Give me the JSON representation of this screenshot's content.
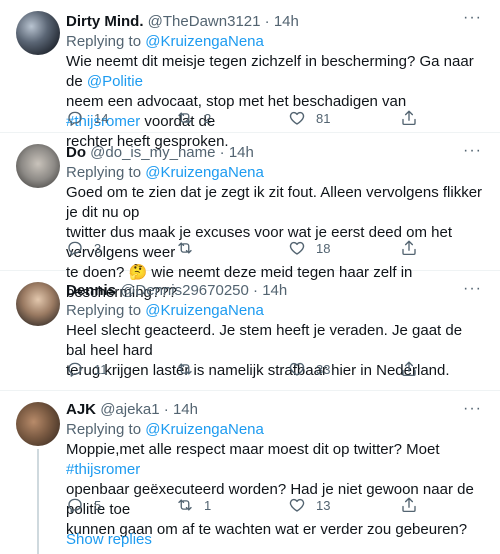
{
  "replies": [
    {
      "name": "Dirty Mind.",
      "handle": "@TheDawn3121",
      "dot": "·",
      "time": "14h",
      "replying_prefix": "Replying to",
      "replying_to": "@KruizengaNena",
      "lines": [
        [
          "Wie neemt dit meisje tegen zichzelf in bescherming? Ga naar de ",
          "@Politie"
        ],
        [
          "neem een advocaat, stop met het beschadigen van ",
          "#thijsromer",
          " voordat de"
        ],
        [
          "rechter heeft gesproken."
        ]
      ],
      "replies_count": "14",
      "retweets_count": "2",
      "likes_count": "81"
    },
    {
      "name": "Do",
      "handle": "@do_is_my_name",
      "dot": "·",
      "time": "14h",
      "replying_prefix": "Replying to",
      "replying_to": "@KruizengaNena",
      "lines": [
        [
          "Goed om te zien dat je zegt ik zit fout. Alleen vervolgens flikker je dit nu op"
        ],
        [
          "twitter dus maak je excuses voor wat je eerst deed om het vervolgens weer"
        ],
        [
          "te doen? 🤔 wie neemt deze meid tegen haar zelf in bescherming???"
        ]
      ],
      "replies_count": "3",
      "retweets_count": "",
      "likes_count": "18"
    },
    {
      "name": "Dennis",
      "handle": "@Dennis29670250",
      "dot": "·",
      "time": "14h",
      "replying_prefix": "Replying to",
      "replying_to": "@KruizengaNena",
      "lines": [
        [
          "Heel slecht geacteerd. Je stem heeft je veraden. Je gaat de bal heel hard"
        ],
        [
          "terug krijgen laster is namelijk strafbaar hier in Nederland."
        ]
      ],
      "replies_count": "11",
      "retweets_count": "",
      "likes_count": "33"
    },
    {
      "name": "AJK",
      "handle": "@ajeka1",
      "dot": "·",
      "time": "14h",
      "replying_prefix": "Replying to",
      "replying_to": "@KruizengaNena",
      "lines": [
        [
          "Moppie,met alle respect maar moest dit op twitter? Moet ",
          "#thijsromer"
        ],
        [
          "openbaar geëxecuteerd worden? Had je niet gewoon naar de politie toe"
        ],
        [
          "kunnen gaan om af te wachten wat er verder zou gebeuren?"
        ]
      ],
      "replies_count": "5",
      "retweets_count": "1",
      "likes_count": "13"
    }
  ],
  "show_replies_label": "Show replies",
  "colors": {
    "link": "#1d9bf0",
    "muted": "#536471",
    "text": "#0f1419",
    "divider": "#eff3f4"
  },
  "icons": [
    "more-icon",
    "reply-icon",
    "retweet-icon",
    "like-icon",
    "share-icon"
  ]
}
